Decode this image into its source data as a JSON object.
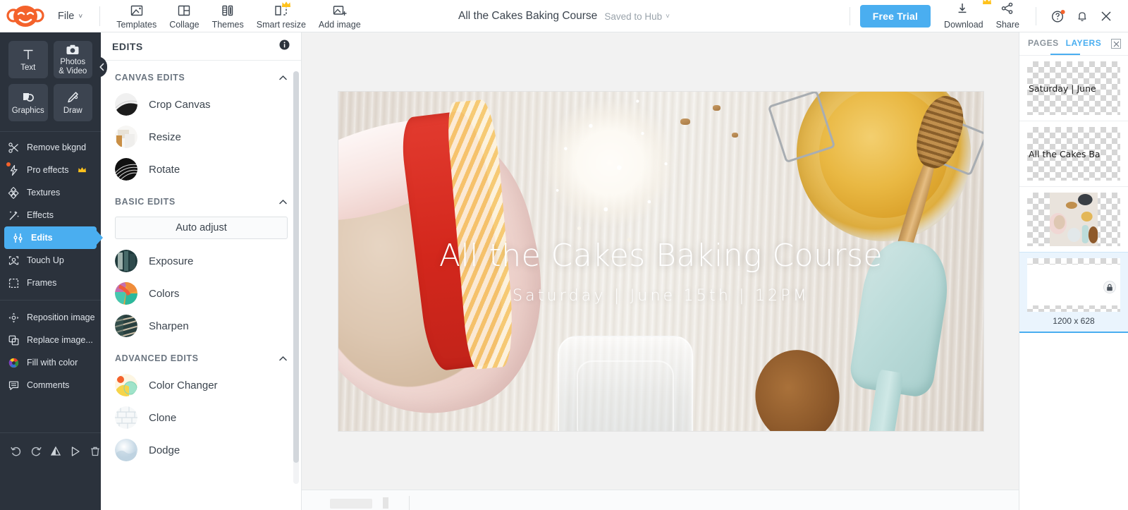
{
  "app": {
    "brand": "PicMonkey",
    "accent_blue": "#4aaef0",
    "orange": "#f4622b",
    "dark_sidebar": "#2b323c"
  },
  "topbar": {
    "logo_icon": "monkey-logo-icon",
    "file_menu": {
      "label": "File",
      "chevron": "˅"
    },
    "tools": [
      {
        "label": "Templates",
        "icon": "templates-icon",
        "pro": false
      },
      {
        "label": "Collage",
        "icon": "collage-icon",
        "pro": false
      },
      {
        "label": "Themes",
        "icon": "themes-icon",
        "pro": false
      },
      {
        "label": "Smart resize",
        "icon": "smart-resize-icon",
        "pro": true
      },
      {
        "label": "Add image",
        "icon": "add-image-icon",
        "pro": false
      }
    ],
    "document_title": "All the Cakes Baking Course",
    "saved_status": "Saved to Hub",
    "saved_chevron": "˅",
    "free_trial_label": "Free Trial",
    "download_label": "Download",
    "share_label": "Share",
    "help_icon": "help-circle-icon",
    "notifications_icon": "bell-icon",
    "close_icon": "close-x-icon"
  },
  "left_rail": {
    "quad": [
      {
        "label": "Text",
        "icon": "text-T-icon"
      },
      {
        "label": "Photos\n& Video",
        "label_line1": "Photos",
        "label_line2": "& Video",
        "icon": "camera-icon"
      },
      {
        "label": "Graphics",
        "icon": "graphics-shapes-icon"
      },
      {
        "label": "Draw",
        "icon": "pencil-draw-icon"
      }
    ],
    "items": [
      {
        "label": "Remove bkgnd",
        "icon": "scissors-icon",
        "pro": true,
        "active": false,
        "dot": false
      },
      {
        "label": "Pro effects",
        "icon": "lightning-bolt-icon",
        "pro": true,
        "active": false,
        "dot": true
      },
      {
        "label": "Textures",
        "icon": "textures-icon",
        "pro": false,
        "active": false,
        "dot": false
      },
      {
        "label": "Effects",
        "icon": "magic-wand-icon",
        "pro": false,
        "active": false,
        "dot": false
      },
      {
        "label": "Edits",
        "icon": "sliders-icon",
        "pro": false,
        "active": true,
        "dot": false
      },
      {
        "label": "Touch Up",
        "icon": "face-touchup-icon",
        "pro": false,
        "active": false,
        "dot": false
      },
      {
        "label": "Frames",
        "icon": "frames-icon",
        "pro": false,
        "active": false,
        "dot": false
      }
    ],
    "items2": [
      {
        "label": "Reposition image",
        "icon": "reposition-move-icon"
      },
      {
        "label": "Replace image...",
        "icon": "replace-image-icon"
      },
      {
        "label": "Fill with color",
        "icon": "color-wheel-icon"
      },
      {
        "label": "Comments",
        "icon": "comment-bubble-icon"
      }
    ],
    "bottom_tools": [
      {
        "icon": "undo-icon",
        "name": "undo"
      },
      {
        "icon": "redo-icon",
        "name": "redo"
      },
      {
        "icon": "flip-vertical-icon",
        "name": "flip"
      },
      {
        "icon": "flip-horizontal-icon",
        "name": "mirror"
      },
      {
        "icon": "trash-icon",
        "name": "delete"
      }
    ],
    "collapse_icon": "chevron-left-icon"
  },
  "edits_panel": {
    "title": "EDITS",
    "info_icon": "info-circle-icon",
    "sections": [
      {
        "heading": "CANVAS EDITS",
        "collapse_icon": "chevron-up-icon",
        "rows": [
          {
            "label": "Crop Canvas",
            "thumb": "crop-canvas-thumb"
          },
          {
            "label": "Resize",
            "thumb": "resize-thumb"
          },
          {
            "label": "Rotate",
            "thumb": "rotate-thumb"
          }
        ]
      },
      {
        "heading": "BASIC EDITS",
        "collapse_icon": "chevron-up-icon",
        "button": "Auto adjust",
        "rows": [
          {
            "label": "Exposure",
            "thumb": "exposure-thumb"
          },
          {
            "label": "Colors",
            "thumb": "colors-thumb"
          },
          {
            "label": "Sharpen",
            "thumb": "sharpen-thumb"
          }
        ]
      },
      {
        "heading": "ADVANCED EDITS",
        "collapse_icon": "chevron-up-icon",
        "rows": [
          {
            "label": "Color Changer",
            "thumb": "color-changer-thumb"
          },
          {
            "label": "Clone",
            "thumb": "clone-thumb"
          },
          {
            "label": "Dodge",
            "thumb": "dodge-thumb"
          }
        ]
      }
    ]
  },
  "canvas": {
    "title_text": "All the Cakes Baking Course",
    "subtitle_text": "Saturday  |  June 15th  |  12PM"
  },
  "right_panel": {
    "tabs": [
      {
        "label": "PAGES",
        "active": false
      },
      {
        "label": "LAYERS",
        "active": true
      }
    ],
    "close_icon": "close-panel-icon",
    "layers": [
      {
        "kind": "text",
        "label": "Saturday | June",
        "selected": false
      },
      {
        "kind": "text",
        "label": "All the Cakes Ba",
        "selected": false
      },
      {
        "kind": "image",
        "label": "",
        "selected": false
      },
      {
        "kind": "background",
        "label": "",
        "selected": true,
        "lock_icon": "lock-icon",
        "size": "1200 x 628"
      }
    ]
  }
}
